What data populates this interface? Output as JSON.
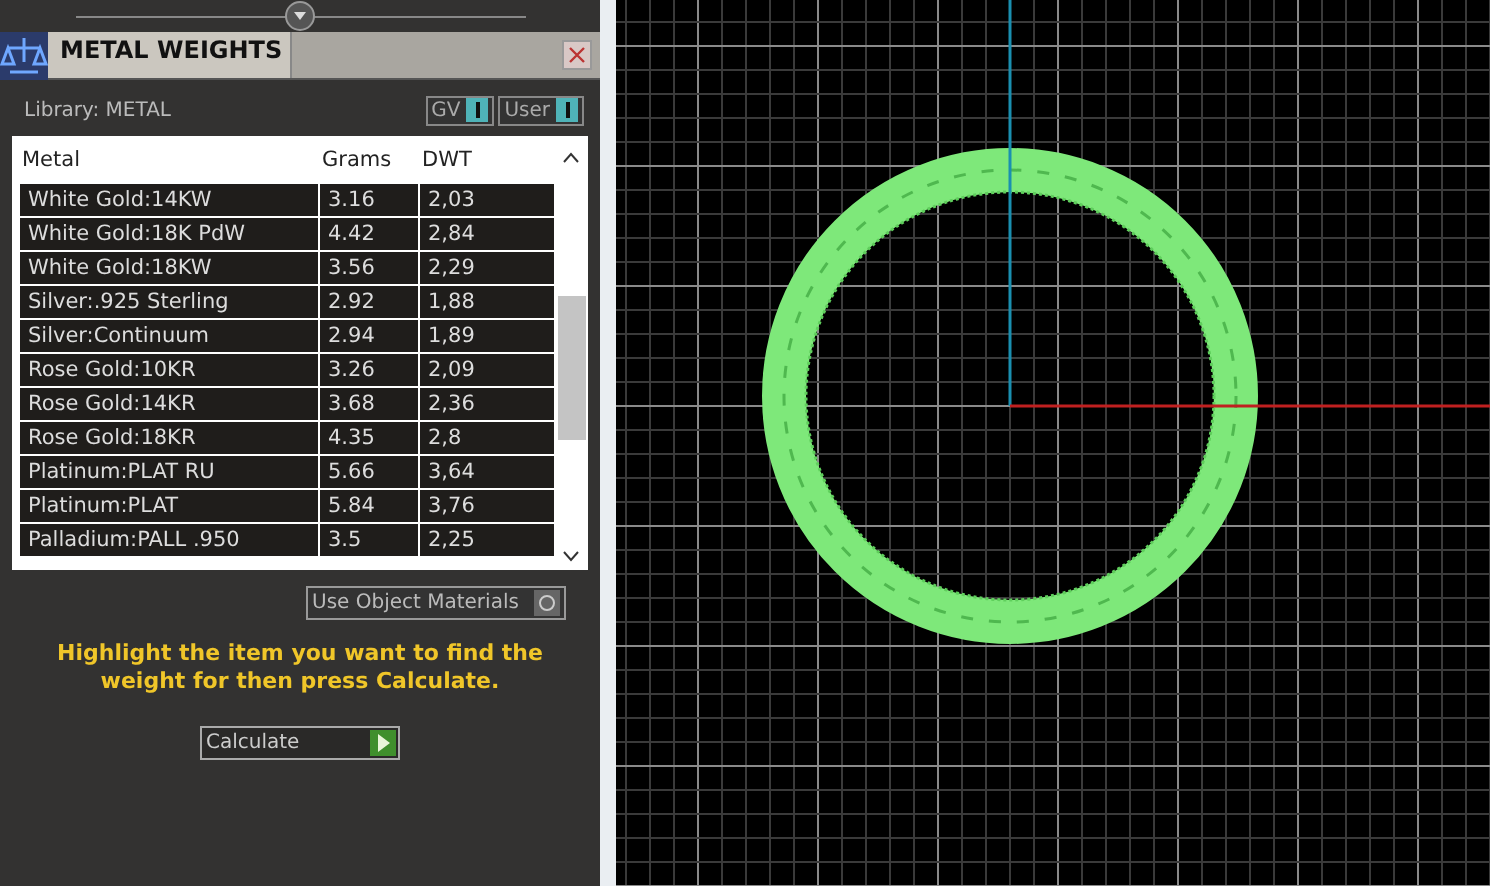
{
  "panel": {
    "title": "METAL WEIGHTS",
    "library": "Library: METAL",
    "toggles": [
      {
        "label": "GV",
        "on": true
      },
      {
        "label": "User",
        "on": true
      }
    ],
    "table": {
      "columns": [
        "Metal",
        "Grams",
        "DWT"
      ],
      "rows": [
        [
          "White Gold:14KW",
          "3.16",
          "2,03"
        ],
        [
          "White Gold:18K PdW",
          "4.42",
          "2,84"
        ],
        [
          "White Gold:18KW",
          "3.56",
          "2,29"
        ],
        [
          "Silver:.925 Sterling",
          "2.92",
          "1,88"
        ],
        [
          "Silver:Continuum",
          "2.94",
          "1,89"
        ],
        [
          "Rose Gold:10KR",
          "3.26",
          "2,09"
        ],
        [
          "Rose Gold:14KR",
          "3.68",
          "2,36"
        ],
        [
          "Rose Gold:18KR",
          "4.35",
          "2,8"
        ],
        [
          "Platinum:PLAT RU",
          "5.66",
          "3,64"
        ],
        [
          "Platinum:PLAT",
          "5.84",
          "3,76"
        ],
        [
          "Palladium:PALL .950",
          "3.5",
          "2,25"
        ]
      ]
    },
    "use_object_materials": {
      "label": "Use Object Materials",
      "on": false
    },
    "hint": "Highlight the item you want to find the weight for then press Calculate.",
    "calculate_button": "Calculate"
  }
}
